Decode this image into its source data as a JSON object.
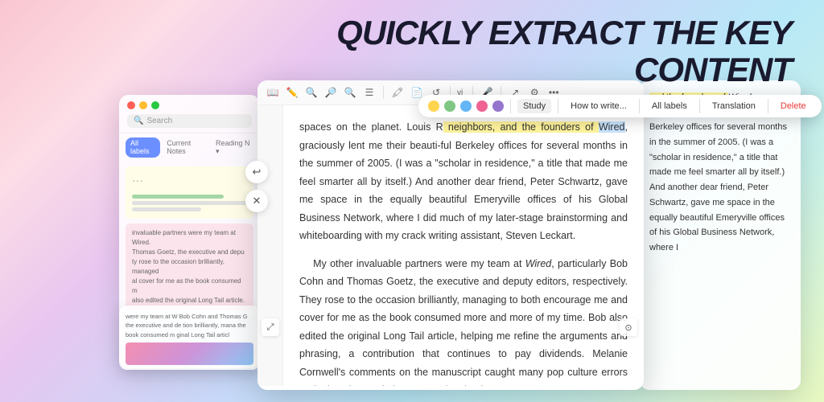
{
  "headline": {
    "line1": "QUICKLY EXTRACT THE KEY",
    "line2": "CONTENT"
  },
  "sidebar": {
    "tabs": {
      "active": "All labels",
      "items": [
        "All labels",
        "Current Notes",
        "Reading N..."
      ]
    },
    "searchPlaceholder": "Search",
    "notes": [
      {
        "id": "note-1",
        "type": "yellow",
        "dots": "...",
        "lines": [
          "green",
          "gray",
          "short"
        ]
      },
      {
        "id": "note-2",
        "type": "yellow",
        "lines": [
          "gray",
          "gray",
          "short"
        ],
        "text": "invaluable partners were my team at Wired. Thomas Goetz, the executive and depu ty rose to the occasion brilliantly, managed al cover for me as the book consumed m also edited the original Long Tail article. De ents and phrasing, a contribution that com elanie Cornwell's comments on the manu ture errors and otherwise made it smart..."
      }
    ]
  },
  "toolbar": {
    "icons": [
      "book",
      "list",
      "grid",
      "mic",
      "bell",
      "more"
    ],
    "colorPicker": {
      "colors": [
        "#FFEB3B",
        "#66BB6A",
        "#42A5F5",
        "#EF5350",
        "#AB47BC"
      ]
    }
  },
  "popup": {
    "colors": [
      "#FFD54F",
      "#81C784",
      "#64B5F6",
      "#F06292",
      "#9575CD"
    ],
    "buttons": [
      "Study",
      "How to write...",
      "All labels",
      "Translation",
      "Delete"
    ]
  },
  "reader": {
    "content": {
      "paragraph1": "spaces on the planet. Louis R neighbors, and the founders of Wired, graciously lent me their beauti-ful Berkeley offices for several months in the summer of 2005. (I was a \"scholar in residence,\" a title that made me feel smarter all by itself.) And another dear friend, Peter Schwartz, gave me space in the equally beautiful Emeryville offices of his Global Business Network, where I did much of my later-stage brainstorming and whiteboarding with my crack writing assistant, Steven Leckart.",
      "paragraph2": "My other invaluable partners were my team at Wired, particularly Bob Cohn and Thomas Goetz, the executive and deputy editors, respectively. They rose to the occasion brilliantly, managing to both encourage me and cover for me as the book consumed more and more of my time. Bob also edited the original Long Tail article, helping me refine the arguments and phrasing, a contribution that continues to pay dividends. Melanie Cornwell's comments on the manuscript caught many pop culture errors and otherwise made it smarter. Also thanks to"
    }
  },
  "rightPanel": {
    "text": "and the founders of Wired, graciously lent me their beauti-ful Berkeley offices for several months in the summer of 2005. (I was a \"scholar in residence,\" a title that made me feel smarter all by itself.) And another dear friend, Peter Schwartz, gave me space in the equally beautiful Emeryville offices of his Global Business Network, where I"
  },
  "controls": {
    "undo": "↩",
    "close": "✕"
  },
  "bottomLeft": {
    "text": "were my team at W Bob Cohn and Thomas G the executive and de tion brilliantly, mana the book consumed m ginal Long Tail articl"
  }
}
